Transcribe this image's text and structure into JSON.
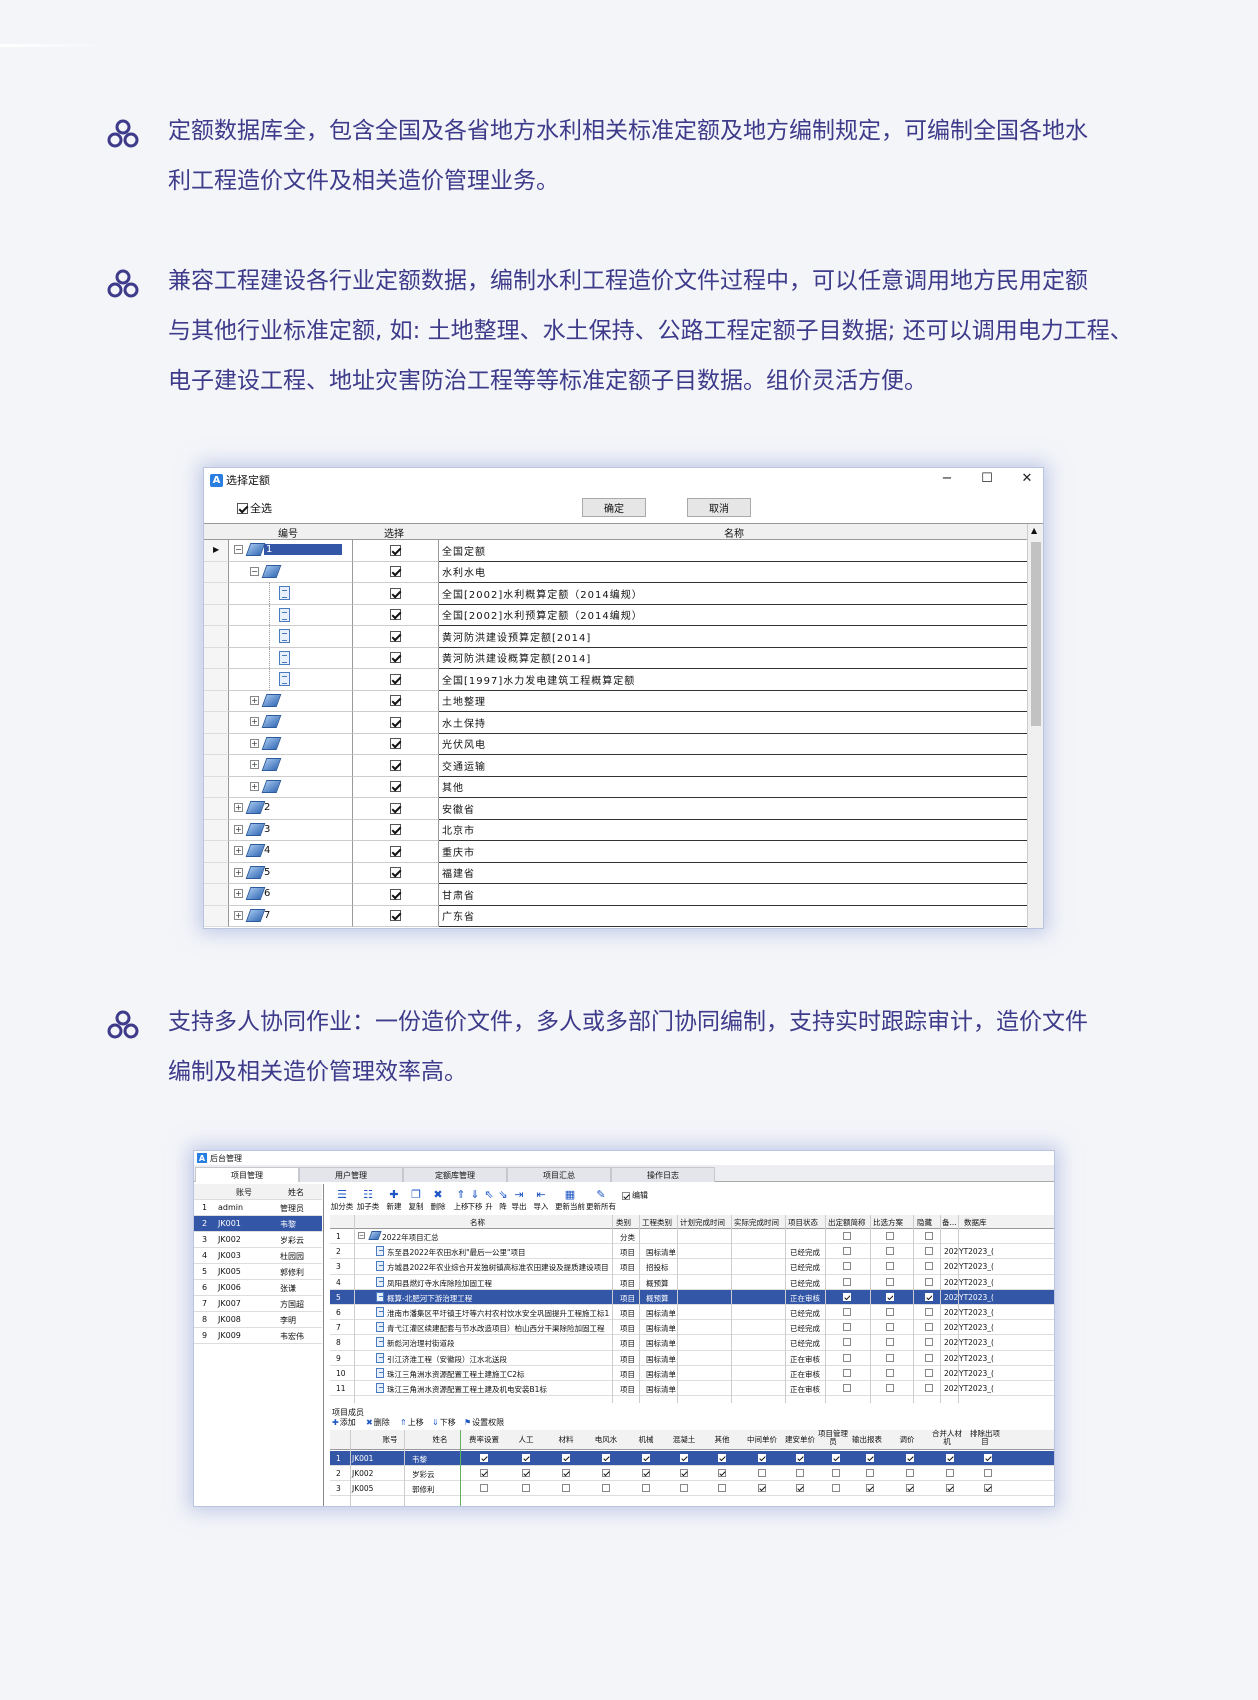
{
  "bullets": [
    {
      "lines": [
        "定额数据库全，包含全国及各省地方水利相关标准定额及地方编制规定，可编制全国各地水",
        "利工程造价文件及相关造价管理业务。"
      ]
    },
    {
      "lines": [
        "兼容工程建设各行业定额数据，编制水利工程造价文件过程中，可以任意调用地方民用定额",
        "与其他行业标准定额, 如: 土地整理、水土保持、公路工程定额子目数据; 还可以调用电力工程、",
        "电子建设工程、地址灾害防治工程等等标准定额子目数据。组价灵活方便。"
      ]
    },
    {
      "lines": [
        "支持多人协同作业：一份造价文件，多人或多部门协同编制，支持实时跟踪审计，造价文件",
        "编制及相关造价管理效率高。"
      ]
    }
  ],
  "dialog": {
    "title": "选择定额",
    "select_all": "全选",
    "ok": "确定",
    "cancel": "取消",
    "columns": [
      "编号",
      "选择",
      "名称"
    ],
    "rows": [
      {
        "no": "1",
        "name": "全国定额",
        "level": 0,
        "icon": "book",
        "expand": "−",
        "current": true
      },
      {
        "no": "",
        "name": "水利水电",
        "level": 1,
        "icon": "book",
        "expand": "−"
      },
      {
        "no": "",
        "name": "全国[2002]水利概算定额（2014编规）",
        "level": 2,
        "icon": "doc",
        "expand": ""
      },
      {
        "no": "",
        "name": "全国[2002]水利预算定额（2014编规）",
        "level": 2,
        "icon": "doc",
        "expand": ""
      },
      {
        "no": "",
        "name": "黄河防洪建设预算定额[2014]",
        "level": 2,
        "icon": "doc",
        "expand": ""
      },
      {
        "no": "",
        "name": "黄河防洪建设概算定额[2014]",
        "level": 2,
        "icon": "doc",
        "expand": ""
      },
      {
        "no": "",
        "name": "全国[1997]水力发电建筑工程概算定额",
        "level": 2,
        "icon": "doc",
        "expand": ""
      },
      {
        "no": "",
        "name": "土地整理",
        "level": 1,
        "icon": "book",
        "expand": "+"
      },
      {
        "no": "",
        "name": "水土保持",
        "level": 1,
        "icon": "book",
        "expand": "+"
      },
      {
        "no": "",
        "name": "光伏风电",
        "level": 1,
        "icon": "book",
        "expand": "+"
      },
      {
        "no": "",
        "name": "交通运输",
        "level": 1,
        "icon": "book",
        "expand": "+"
      },
      {
        "no": "",
        "name": "其他",
        "level": 1,
        "icon": "book",
        "expand": "+"
      },
      {
        "no": "2",
        "name": "安徽省",
        "level": 0,
        "icon": "book",
        "expand": "+"
      },
      {
        "no": "3",
        "name": "北京市",
        "level": 0,
        "icon": "book",
        "expand": "+"
      },
      {
        "no": "4",
        "name": "重庆市",
        "level": 0,
        "icon": "book",
        "expand": "+"
      },
      {
        "no": "5",
        "name": "福建省",
        "level": 0,
        "icon": "book",
        "expand": "+"
      },
      {
        "no": "6",
        "name": "甘肃省",
        "level": 0,
        "icon": "book",
        "expand": "+"
      },
      {
        "no": "7",
        "name": "广东省",
        "level": 0,
        "icon": "book",
        "expand": "+"
      }
    ]
  },
  "admin": {
    "title": "后台管理",
    "tabs": [
      "项目管理",
      "用户管理",
      "定额库管理",
      "项目汇总",
      "操作日志"
    ],
    "user_cols": [
      "账号",
      "姓名"
    ],
    "users": [
      {
        "n": "1",
        "acc": "admin",
        "name": "管理员"
      },
      {
        "n": "2",
        "acc": "JK001",
        "name": "韦黎",
        "sel": true
      },
      {
        "n": "3",
        "acc": "JK002",
        "name": "岁彩云"
      },
      {
        "n": "4",
        "acc": "JK003",
        "name": "杜园园"
      },
      {
        "n": "5",
        "acc": "JK005",
        "name": "郭修利"
      },
      {
        "n": "6",
        "acc": "JK006",
        "name": "张谦"
      },
      {
        "n": "7",
        "acc": "JK007",
        "name": "方国超"
      },
      {
        "n": "8",
        "acc": "JK008",
        "name": "李明"
      },
      {
        "n": "9",
        "acc": "JK009",
        "name": "韦宏伟"
      }
    ],
    "toolbar": [
      {
        "label": "加分类",
        "icon": "☰"
      },
      {
        "label": "加子类",
        "icon": "☷"
      },
      {
        "label": "新建",
        "icon": "✚"
      },
      {
        "label": "复制",
        "icon": "❐"
      },
      {
        "label": "删除",
        "icon": "✖"
      },
      {
        "label": "上移",
        "icon": "⇑"
      },
      {
        "label": "下移",
        "icon": "⇓"
      },
      {
        "label": "升",
        "icon": "⇖"
      },
      {
        "label": "降",
        "icon": "⇘"
      },
      {
        "label": "导出",
        "icon": "⇥"
      },
      {
        "label": "导入",
        "icon": "⇤"
      },
      {
        "label": "更新当前",
        "icon": "▦"
      },
      {
        "label": "更新所有",
        "icon": "✎"
      }
    ],
    "edit_label": "编辑",
    "proj_cols": [
      "名称",
      "类别",
      "工程类别",
      "计划完成时间",
      "实际完成时间",
      "项目状态",
      "出定额简称",
      "比选方案",
      "隐藏",
      "备...",
      "数据库"
    ],
    "projects": [
      {
        "n": "1",
        "name": "2022年项目汇总",
        "cat": "分类",
        "type": "",
        "status": "",
        "year": "",
        "db": "",
        "folder": true
      },
      {
        "n": "2",
        "name": "东至县2022年农田水利\"最后一公里\"项目",
        "cat": "项目",
        "type": "国标清单",
        "status": "已经完成",
        "year": "202",
        "db": "YT2023_("
      },
      {
        "n": "3",
        "name": "方城县2022年农业综合开发独树镇高标准农田建设及提质建设项目7",
        "cat": "项目",
        "type": "招投标",
        "status": "已经完成",
        "year": "202",
        "db": "YT2023_("
      },
      {
        "n": "4",
        "name": "凤阳县燃灯寺水库除险加固工程",
        "cat": "项目",
        "type": "概预算",
        "status": "已经完成",
        "year": "202",
        "db": "YT2023_("
      },
      {
        "n": "5",
        "name": "概算-北肥河下游治理工程",
        "cat": "项目",
        "type": "概预算",
        "status": "正在审核",
        "year": "202",
        "db": "YT2023_(",
        "sel": true
      },
      {
        "n": "6",
        "name": "淮南市潘集区平圩镇王圩等六村农村饮水安全巩固提升工程施工标1",
        "cat": "项目",
        "type": "国标清单",
        "status": "已经完成",
        "year": "202",
        "db": "YT2023_("
      },
      {
        "n": "7",
        "name": "青弋江灌区续建配套与节水改造项目）柏山西分干渠除险加固工程",
        "cat": "项目",
        "type": "国标清单",
        "status": "已经完成",
        "year": "202",
        "db": "YT2023_("
      },
      {
        "n": "8",
        "name": "新彪河治理衬街道段",
        "cat": "项目",
        "type": "国标清单",
        "status": "已经完成",
        "year": "202",
        "db": "YT2023_("
      },
      {
        "n": "9",
        "name": "引江济淮工程（安徽段）江水北送段",
        "cat": "项目",
        "type": "国标清单",
        "status": "正在审核",
        "year": "202",
        "db": "YT2023_("
      },
      {
        "n": "10",
        "name": "珠江三角洲水资源配置工程土建施工C2标",
        "cat": "项目",
        "type": "国标清单",
        "status": "正在审核",
        "year": "202",
        "db": "YT2023_("
      },
      {
        "n": "11",
        "name": "珠江三角洲水资源配置工程土建及机电安装B1标",
        "cat": "项目",
        "type": "国标清单",
        "status": "正在审核",
        "year": "202",
        "db": "YT2023_("
      }
    ],
    "members_title": "项目成员",
    "member_tools": [
      "添加",
      "删除",
      "上移",
      "下移",
      "设置权限"
    ],
    "member_cols": [
      "账号",
      "姓名",
      "费率设置",
      "人工",
      "材料",
      "电风水",
      "机械",
      "混凝土",
      "其他",
      "中间单价",
      "建安单价",
      "项目管理员",
      "输出报表",
      "调价",
      "合并人材机",
      "排除出项目"
    ],
    "members": [
      {
        "n": "1",
        "acc": "JK001",
        "name": "韦黎",
        "sel": true,
        "flags": [
          1,
          1,
          1,
          1,
          1,
          1,
          1,
          1,
          1,
          1,
          1,
          1,
          1,
          1
        ]
      },
      {
        "n": "2",
        "acc": "JK002",
        "name": "岁彩云",
        "flags": [
          1,
          1,
          1,
          1,
          1,
          1,
          1,
          0,
          0,
          0,
          0,
          0,
          0,
          0
        ]
      },
      {
        "n": "3",
        "acc": "JK005",
        "name": "郭修利",
        "flags": [
          0,
          0,
          0,
          0,
          0,
          0,
          0,
          1,
          1,
          0,
          1,
          1,
          1,
          1
        ]
      }
    ]
  }
}
